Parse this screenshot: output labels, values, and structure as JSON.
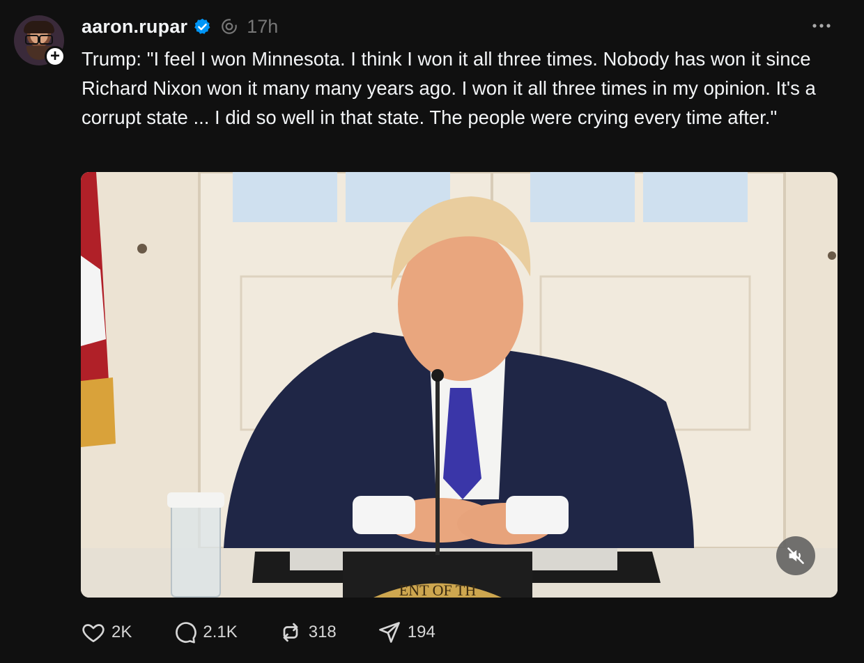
{
  "post": {
    "username": "aaron.rupar",
    "verified": true,
    "timestamp": "17h",
    "text": "Trump: \"I feel I won Minnesota. I think I won it all three times. Nobody has won it since Richard Nixon won it many many years ago. I won it all three times in my opinion. It's a corrupt state ... I did so well in that state. The people were crying every time after.\"",
    "media": {
      "type": "video",
      "muted": true,
      "seal_text": "ENT OF TH"
    }
  },
  "actions": {
    "like_count": "2K",
    "reply_count": "2.1K",
    "repost_count": "318",
    "share_count": "194"
  },
  "icons": {
    "verified": "verified-badge-icon",
    "thread": "threads-icon",
    "more": "more-horizontal-icon",
    "like": "heart-icon",
    "reply": "comment-icon",
    "repost": "repost-icon",
    "share": "send-icon",
    "mute": "speaker-muted-icon",
    "follow": "plus-icon"
  },
  "colors": {
    "background": "#101010",
    "text_primary": "#f3f5f7",
    "text_secondary": "#777777",
    "verified_blue": "#0095f6"
  }
}
